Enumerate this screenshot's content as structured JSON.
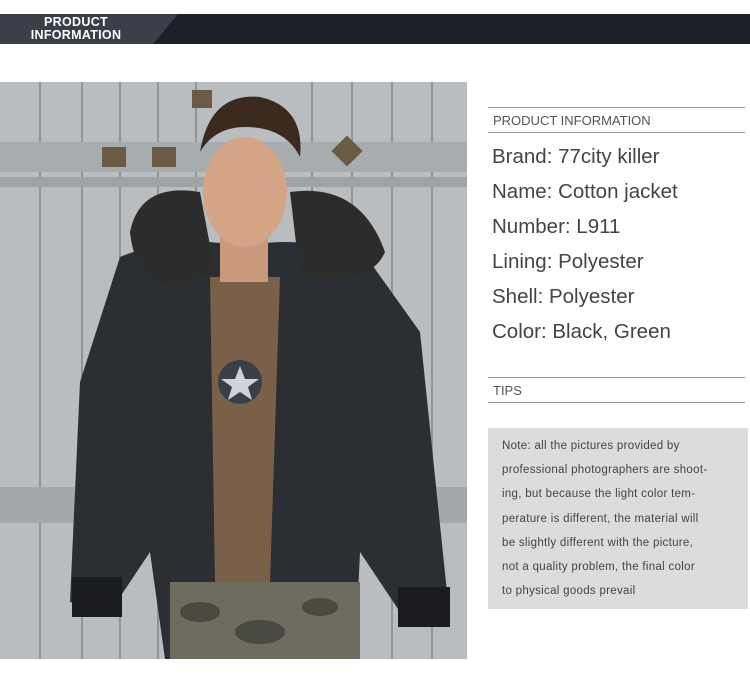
{
  "header": {
    "line1": "PRODUCT",
    "line2": "INFORMATION"
  },
  "product_info": {
    "heading": "PRODUCT INFORMATION",
    "rows": [
      "Brand: 77city killer",
      "Name: Cotton jacket",
      "Number: L911",
      "Lining: Polyester",
      "Shell: Polyester",
      "Color: Black,  Green"
    ]
  },
  "tips": {
    "heading": "TIPS",
    "note_lines": [
      "Note: all the pictures provided by",
      "professional photographers are shoot-",
      "ing, but because the light color tem-",
      "perature is different, the material will",
      "be slightly different with the picture,",
      "not a quality problem, the final color",
      "to physical goods prevail"
    ]
  },
  "colors": {
    "header_dark": "#1d2029",
    "header_tab": "#3b3f4a",
    "note_bg": "#dcdcdc"
  }
}
